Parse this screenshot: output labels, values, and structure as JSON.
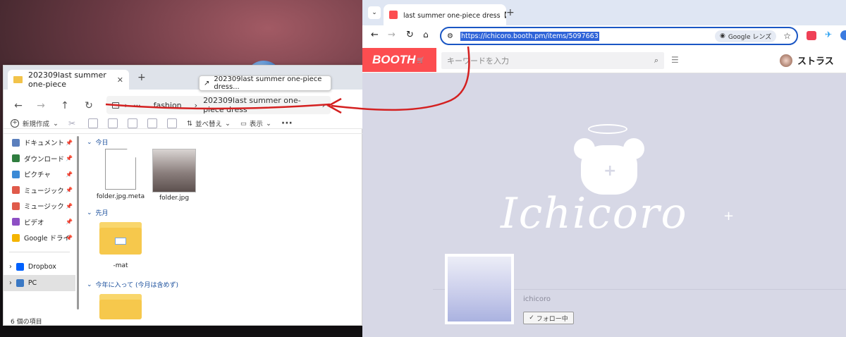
{
  "explorer": {
    "tab_title": "202309last summer one-piece",
    "new_tab_symbol": "+",
    "breadcrumb": {
      "ellipsis": "···",
      "parent": "fashion",
      "current": "202309last summer one-piece dress"
    },
    "tooltip": "202309last summer one-piece dress...",
    "toolbar": {
      "new": "新規作成",
      "sort": "並べ替え",
      "view": "表示",
      "more": "···"
    },
    "sidebar": [
      {
        "label": "ドキュメント",
        "color": "#5b7fbd",
        "pinned": true
      },
      {
        "label": "ダウンロード",
        "color": "#2f7d3f",
        "pinned": true
      },
      {
        "label": "ピクチャ",
        "color": "#3b8ad6",
        "pinned": true
      },
      {
        "label": "ミュージック",
        "color": "#e05a4a",
        "pinned": true
      },
      {
        "label": "ミュージック",
        "color": "#e05a4a",
        "pinned": true
      },
      {
        "label": "ビデオ",
        "color": "#8d4fc4",
        "pinned": true
      },
      {
        "label": "Google ドライ",
        "color": "#f4b400",
        "pinned": true
      }
    ],
    "sidebar_bottom": [
      {
        "label": "Dropbox",
        "color": "#0061fe"
      },
      {
        "label": "PC",
        "color": "#3a78c4"
      }
    ],
    "groups": {
      "today": "今日",
      "last_month": "先月",
      "this_year": "今年に入って (今月は含めず)"
    },
    "files_today": [
      {
        "name": "folder.jpg.meta",
        "kind": "document"
      },
      {
        "name": "folder.jpg",
        "kind": "image"
      }
    ],
    "files_last_month": [
      {
        "name": "-mat",
        "kind": "folder"
      }
    ],
    "status": "6 個の項目"
  },
  "browser": {
    "tab_title": "last summer one-piece dress【",
    "new_tab_symbol": "+",
    "url": "https://ichicoro.booth.pm/items/5097663",
    "google_lens": "Google レンズ",
    "booth": {
      "logo": "BOOTH",
      "search_placeholder": "キーワードを入力",
      "username": "ストラス",
      "shop_name": "ichicoro",
      "shop_logo_text": "Ichicoro",
      "follow_label": "フォロー中",
      "brand_color": "#fc4d50"
    }
  },
  "annotation": {
    "color": "#d42020"
  }
}
